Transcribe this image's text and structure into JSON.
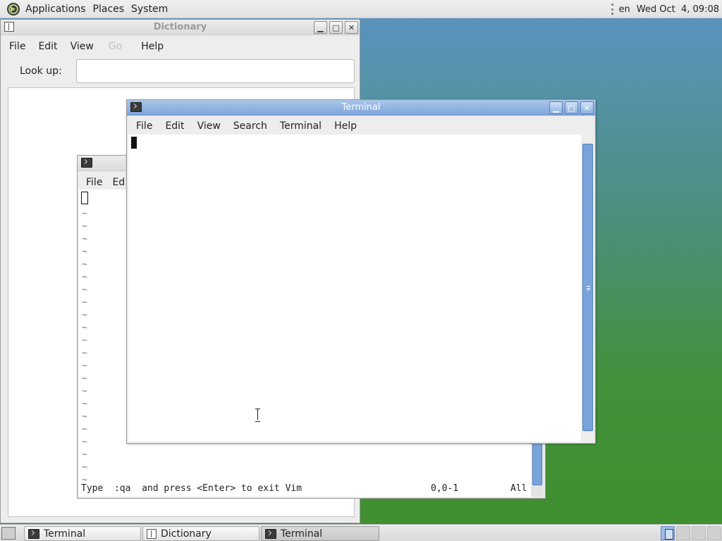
{
  "top_panel": {
    "menus": [
      "Applications",
      "Places",
      "System"
    ],
    "language": "en",
    "clock": "Wed Oct  4, 09:08"
  },
  "dictionary": {
    "title": "Dictionary",
    "menu": [
      "File",
      "Edit",
      "View",
      "Go",
      "Help"
    ],
    "lookup_label": "Look up:",
    "lookup_value": ""
  },
  "vim_terminal": {
    "menu": [
      "File",
      "Ed"
    ],
    "tilde": "~",
    "status_message": "Type  :qa  and press <Enter> to exit Vim",
    "position": "0,0-1",
    "scroll_position": "All"
  },
  "terminal": {
    "title": "Terminal",
    "menu": [
      "File",
      "Edit",
      "View",
      "Search",
      "Terminal",
      "Help"
    ]
  },
  "taskbar": {
    "items": [
      {
        "label": "Terminal",
        "icon": "terminal-icon",
        "active": false
      },
      {
        "label": "Dictionary",
        "icon": "dictionary-icon",
        "active": false
      },
      {
        "label": "Terminal",
        "icon": "terminal-icon",
        "active": true
      }
    ]
  },
  "colors": {
    "active_titlebar": "#7ea5dc",
    "scrollbar_thumb": "#79a4db",
    "desktop_top": "#5b93c3",
    "desktop_bottom": "#3f8f2e"
  }
}
